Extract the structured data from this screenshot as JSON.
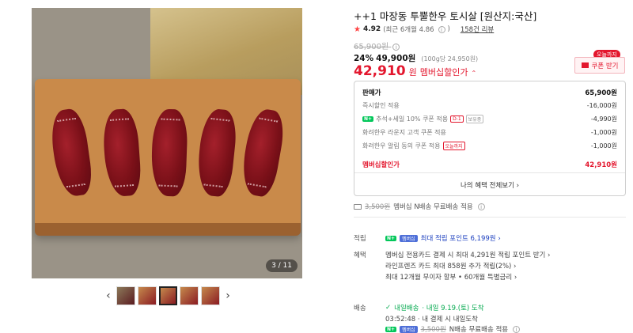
{
  "gallery": {
    "counter": "3 / 11",
    "prev_icon": "‹",
    "next_icon": "›",
    "thumb_count": 5
  },
  "product": {
    "title": "++1 마장동 투뿔한우 토시살 [원산지:국산]",
    "rating": "4.92",
    "rating_recent": "(최근 6개월 4.86",
    "review_count": "158건 리뷰",
    "original_price": "65,900원",
    "discount_percent": "24%",
    "discount_price": "49,900원",
    "unit_price": "(100g당 24,950원)",
    "member_price_value": "42,910",
    "member_price_unit": "원",
    "member_price_label": "멤버십할인가"
  },
  "coupon": {
    "today_badge": "오늘까지",
    "button_label": "쿠폰 받기"
  },
  "breakdown": {
    "rows": [
      {
        "label": "판매가",
        "value": "65,900원"
      },
      {
        "label": "즉시할인 적용",
        "value": "-16,000원"
      },
      {
        "label": "추석+세일 10% 쿠폰 적용",
        "tag": "D-1",
        "tag2": "보유중",
        "value": "-4,990원"
      },
      {
        "label": "화려한우 라운지 고객 쿠폰 적용",
        "value": "-1,000원"
      },
      {
        "label": "화려한우 알림 동의 쿠폰 적용",
        "tag": "오늘까지",
        "value": "-1,000원"
      }
    ],
    "total_label": "멤버십할인가",
    "total_value": "42,910원",
    "more_link": "나의 혜택 전체보기 ›"
  },
  "shipping_line": {
    "strike": "3,500원",
    "text": "멤버십 N배송 무료배송 적용"
  },
  "sections": {
    "points_label": "적립",
    "points_badge": "멤버십",
    "points_text": "최대 적립 포인트 6,199원 ›",
    "benefits_label": "혜택",
    "benefits": [
      "멤버십 전용카드 결제 시 최대 4,291원 적립 포인트 받기 ›",
      "라인프렌즈 카드 최대 858원 추가 적립(2%) ›",
      "최대 12개월 무이자 할부 • 60개월 특별금리 ›"
    ],
    "delivery_label": "배송",
    "delivery_brand": "내일배송",
    "delivery_date": "· 내일 9.19.(토) 도착",
    "delivery_cutoff": "03:52:48 · 내 결제 시 내일도착",
    "delivery_badge": "멤버십",
    "delivery_strike": "3,500원",
    "delivery_text": "N배송 무료배송 적용"
  },
  "colors": {
    "accent_red": "#e3162d",
    "naver_green": "#03c75a",
    "link_blue": "#1c3fbf"
  }
}
